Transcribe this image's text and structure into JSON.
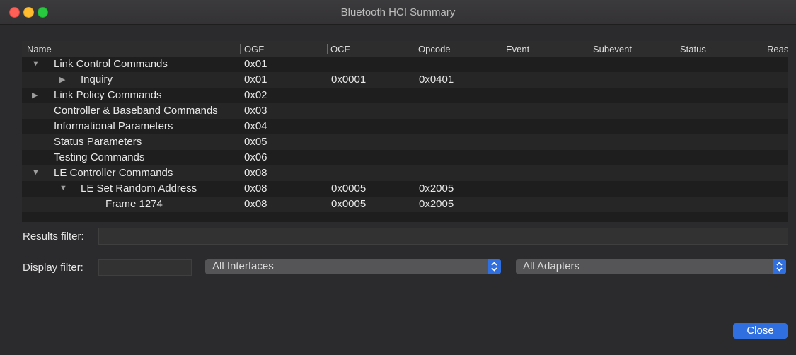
{
  "window": {
    "title": "Bluetooth HCI Summary"
  },
  "table": {
    "columns": [
      "Name",
      "OGF",
      "OCF",
      "Opcode",
      "Event",
      "Subevent",
      "Status",
      "Reas"
    ],
    "rows": [
      {
        "name": "Link Control Commands",
        "ogf": "0x01",
        "ocf": "",
        "opcode": "",
        "expander": "expanded"
      },
      {
        "name": "Inquiry",
        "ogf": "0x01",
        "ocf": "0x0001",
        "opcode": "0x0401",
        "expander": "collapsed"
      },
      {
        "name": "Link Policy Commands",
        "ogf": "0x02",
        "ocf": "",
        "opcode": "",
        "expander": "collapsed"
      },
      {
        "name": "Controller & Baseband Commands",
        "ogf": "0x03",
        "ocf": "",
        "opcode": "",
        "expander": "none"
      },
      {
        "name": "Informational Parameters",
        "ogf": "0x04",
        "ocf": "",
        "opcode": "",
        "expander": "none"
      },
      {
        "name": "Status Parameters",
        "ogf": "0x05",
        "ocf": "",
        "opcode": "",
        "expander": "none"
      },
      {
        "name": "Testing Commands",
        "ogf": "0x06",
        "ocf": "",
        "opcode": "",
        "expander": "none"
      },
      {
        "name": "LE Controller Commands",
        "ogf": "0x08",
        "ocf": "",
        "opcode": "",
        "expander": "expanded"
      },
      {
        "name": "LE Set Random Address",
        "ogf": "0x08",
        "ocf": "0x0005",
        "opcode": "0x2005",
        "expander": "expanded"
      },
      {
        "name": "Frame 1274",
        "ogf": "0x08",
        "ocf": "0x0005",
        "opcode": "0x2005",
        "expander": "none"
      }
    ]
  },
  "filters": {
    "results_label": "Results filter:",
    "results_value": "",
    "display_label": "Display filter:",
    "display_value": "",
    "interfaces_selected": "All Interfaces",
    "adapters_selected": "All Adapters"
  },
  "buttons": {
    "close_label": "Close"
  },
  "icons": {
    "expanded": "triangle-down-icon",
    "collapsed": "triangle-right-icon",
    "stepper": "up-down-chevron-icon"
  },
  "colors": {
    "accent": "#2f6fe0"
  }
}
